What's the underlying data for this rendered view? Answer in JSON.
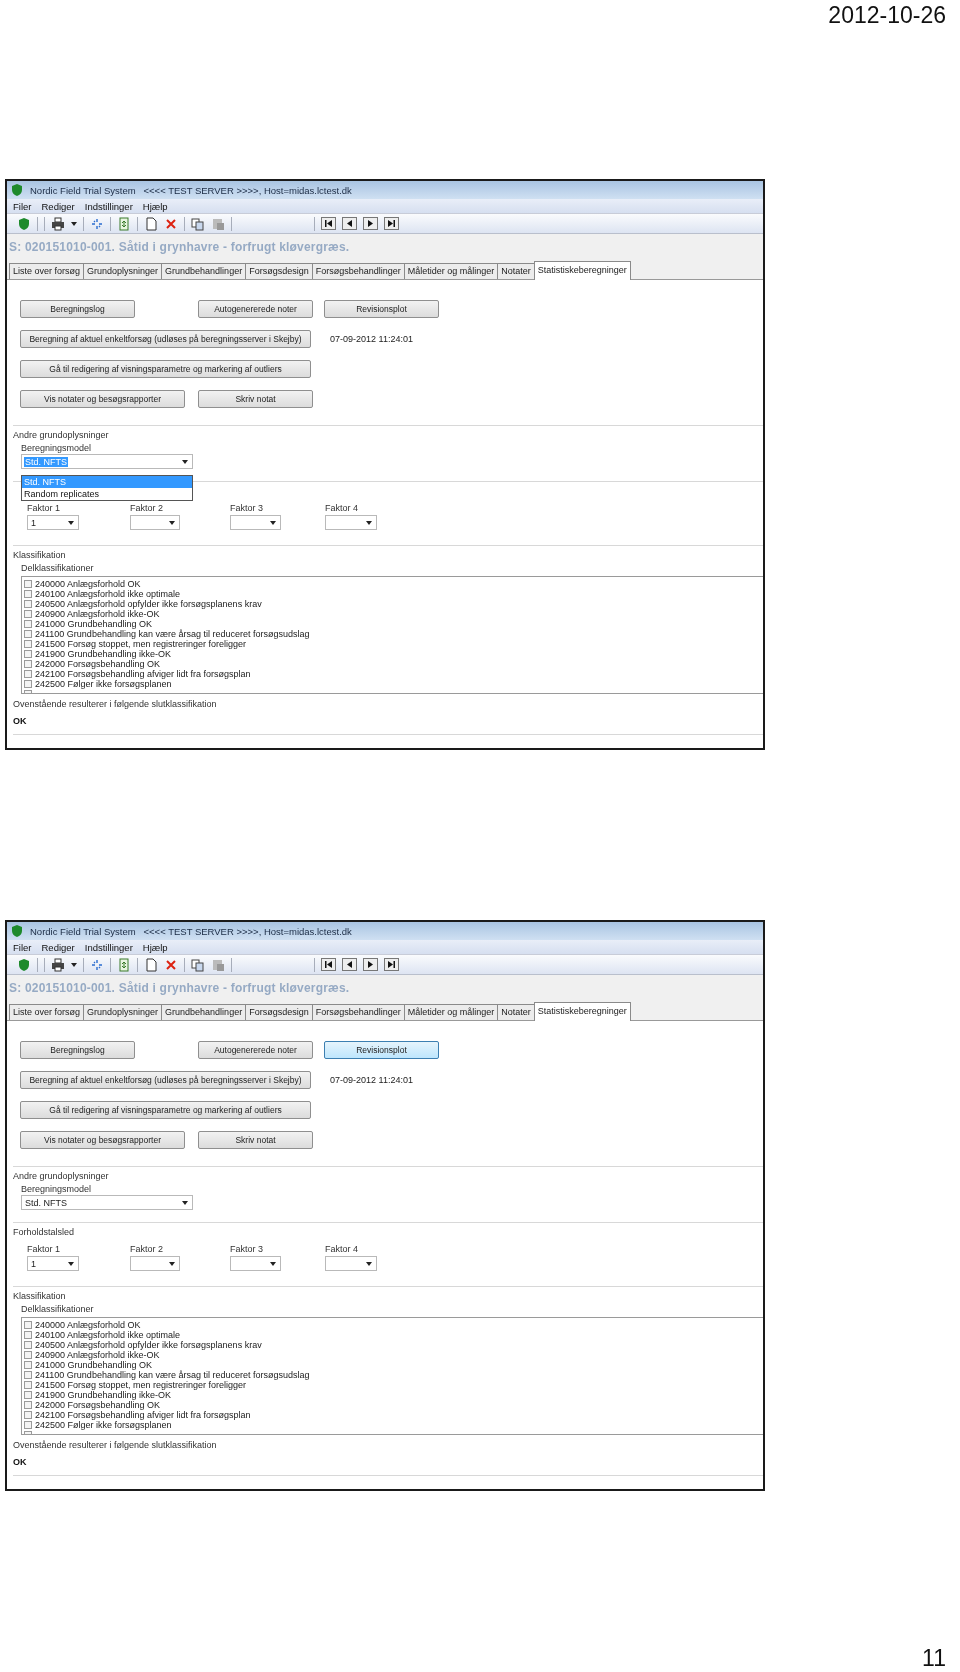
{
  "page": {
    "date": "2012-10-26",
    "page_number": "11"
  },
  "screens": [
    {
      "title": "Nordic Field Trial System   <<<< TEST SERVER >>>>, Host=midas.lctest.dk",
      "menu": [
        "Filer",
        "Rediger",
        "Indstillinger",
        "Hjælp"
      ],
      "trial": "S: 020151010-001. Såtid i grynhavre - forfrugt kløvergræs.",
      "tabs": [
        {
          "label": "Liste over forsøg",
          "selected": false
        },
        {
          "label": "Grundoplysninger",
          "selected": false
        },
        {
          "label": "Grundbehandlinger",
          "selected": false
        },
        {
          "label": "Forsøgsdesign",
          "selected": false
        },
        {
          "label": "Forsøgsbehandlinger",
          "selected": false
        },
        {
          "label": "Måletider og målinger",
          "selected": false
        },
        {
          "label": "Notater",
          "selected": false
        },
        {
          "label": "Statistiskeberegninger",
          "selected": true
        }
      ],
      "button_rows": [
        {
          "buttons": [
            {
              "label": "Beregningslog",
              "kind": "small",
              "hovered": false
            },
            {
              "label": "Autogenererede noter",
              "kind": "small",
              "hovered": false
            },
            {
              "label": "Revisionsplot",
              "kind": "small",
              "hovered": false
            }
          ]
        },
        {
          "buttons": [
            {
              "label": "Beregning af aktuel enkeltforsøg (udløses på beregningsserver i Skejby)",
              "kind": "wide",
              "hovered": false
            }
          ],
          "note": "07-09-2012 11:24:01"
        },
        {
          "buttons": [
            {
              "label": "Gå til redigering af visningsparametre og markering af outliers",
              "kind": "wide",
              "hovered": false
            }
          ]
        },
        {
          "buttons": [
            {
              "label": "Vis notater og besøgsrapporter",
              "kind": "medium",
              "hovered": false
            },
            {
              "label": "Skriv notat",
              "kind": "small",
              "hovered": false
            }
          ]
        }
      ],
      "other_info": {
        "label": "Andre grundoplysninger",
        "model_label": "Beregningsmodel",
        "model_value": "Std. NFTS",
        "value_selected": true,
        "options": [
          {
            "label": "Std. NFTS",
            "selected": true
          },
          {
            "label": "Random replicates",
            "selected": false
          }
        ]
      },
      "ratio": {
        "factors": [
          {
            "label": "Faktor 1",
            "value": "1"
          },
          {
            "label": "Faktor 2"
          },
          {
            "label": "Faktor 3"
          },
          {
            "label": "Faktor 4"
          }
        ]
      },
      "classification": {
        "label": "Klassifikation",
        "list_label": "Delklassifikationer",
        "items": [
          {
            "label": "240000 Anlægsforhold OK",
            "checked": false
          },
          {
            "label": "240100 Anlægsforhold ikke optimale",
            "checked": false
          },
          {
            "label": "240500 Anlægsforhold opfylder ikke forsøgsplanens krav",
            "checked": false
          },
          {
            "label": "240900 Anlægsforhold ikke-OK",
            "checked": false
          },
          {
            "label": "241000 Grundbehandling OK",
            "checked": false
          },
          {
            "label": "241100 Grundbehandling kan være årsag til reduceret forsøgsudslag",
            "checked": false
          },
          {
            "label": "241500 Forsøg stoppet, men registreringer foreligger",
            "checked": false
          },
          {
            "label": "241900 Grundbehandling ikke-OK",
            "checked": false
          },
          {
            "label": "242000 Forsøgsbehandling OK",
            "checked": false
          },
          {
            "label": "242100 Forsøgsbehandling afviger lidt fra forsøgsplan",
            "checked": false
          },
          {
            "label": "242500 Følger ikke forsøgsplanen",
            "checked": false
          }
        ],
        "result_label": "Ovenstående resulterer i følgende slutklassifikation",
        "result": "OK"
      }
    },
    {
      "title": "Nordic Field Trial System   <<<< TEST SERVER >>>>, Host=midas.lctest.dk",
      "menu": [
        "Filer",
        "Rediger",
        "Indstillinger",
        "Hjælp"
      ],
      "trial": "S: 020151010-001. Såtid i grynhavre - forfrugt kløvergræs.",
      "tabs": [
        {
          "label": "Liste over forsøg",
          "selected": false
        },
        {
          "label": "Grundoplysninger",
          "selected": false
        },
        {
          "label": "Grundbehandlinger",
          "selected": false
        },
        {
          "label": "Forsøgsdesign",
          "selected": false
        },
        {
          "label": "Forsøgsbehandlinger",
          "selected": false
        },
        {
          "label": "Måletider og målinger",
          "selected": false
        },
        {
          "label": "Notater",
          "selected": false
        },
        {
          "label": "Statistiskeberegninger",
          "selected": true
        }
      ],
      "button_rows": [
        {
          "buttons": [
            {
              "label": "Beregningslog",
              "kind": "small",
              "hovered": false
            },
            {
              "label": "Autogenererede noter",
              "kind": "small",
              "hovered": false
            },
            {
              "label": "Revisionsplot",
              "kind": "small",
              "hovered": true
            }
          ]
        },
        {
          "buttons": [
            {
              "label": "Beregning af aktuel enkeltforsøg (udløses på beregningsserver i Skejby)",
              "kind": "wide",
              "hovered": false
            }
          ],
          "note": "07-09-2012 11:24:01"
        },
        {
          "buttons": [
            {
              "label": "Gå til redigering af visningsparametre og markering af outliers",
              "kind": "wide",
              "hovered": false
            }
          ]
        },
        {
          "buttons": [
            {
              "label": "Vis notater og besøgsrapporter",
              "kind": "medium",
              "hovered": false
            },
            {
              "label": "Skriv notat",
              "kind": "small",
              "hovered": false
            }
          ]
        }
      ],
      "other_info": {
        "label": "Andre grundoplysninger",
        "model_label": "Beregningsmodel",
        "model_value": "Std. NFTS",
        "value_selected": false
      },
      "ratio": {
        "label": "Forholdstalsled",
        "factors": [
          {
            "label": "Faktor 1",
            "value": "1"
          },
          {
            "label": "Faktor 2"
          },
          {
            "label": "Faktor 3"
          },
          {
            "label": "Faktor 4"
          }
        ]
      },
      "classification": {
        "label": "Klassifikation",
        "list_label": "Delklassifikationer",
        "items": [
          {
            "label": "240000 Anlægsforhold OK",
            "checked": false
          },
          {
            "label": "240100 Anlægsforhold ikke optimale",
            "checked": false
          },
          {
            "label": "240500 Anlægsforhold opfylder ikke forsøgsplanens krav",
            "checked": false
          },
          {
            "label": "240900 Anlægsforhold ikke-OK",
            "checked": false
          },
          {
            "label": "241000 Grundbehandling OK",
            "checked": false
          },
          {
            "label": "241100 Grundbehandling kan være årsag til reduceret forsøgsudslag",
            "checked": false
          },
          {
            "label": "241500 Forsøg stoppet, men registreringer foreligger",
            "checked": false
          },
          {
            "label": "241900 Grundbehandling ikke-OK",
            "checked": false
          },
          {
            "label": "242000 Forsøgsbehandling OK",
            "checked": false
          },
          {
            "label": "242100 Forsøgsbehandling afviger lidt fra forsøgsplan",
            "checked": false
          },
          {
            "label": "242500 Følger ikke forsøgsplanen",
            "checked": false
          }
        ],
        "result_label": "Ovenstående resulterer i følgende slutklassifikation",
        "result": "OK"
      }
    }
  ]
}
